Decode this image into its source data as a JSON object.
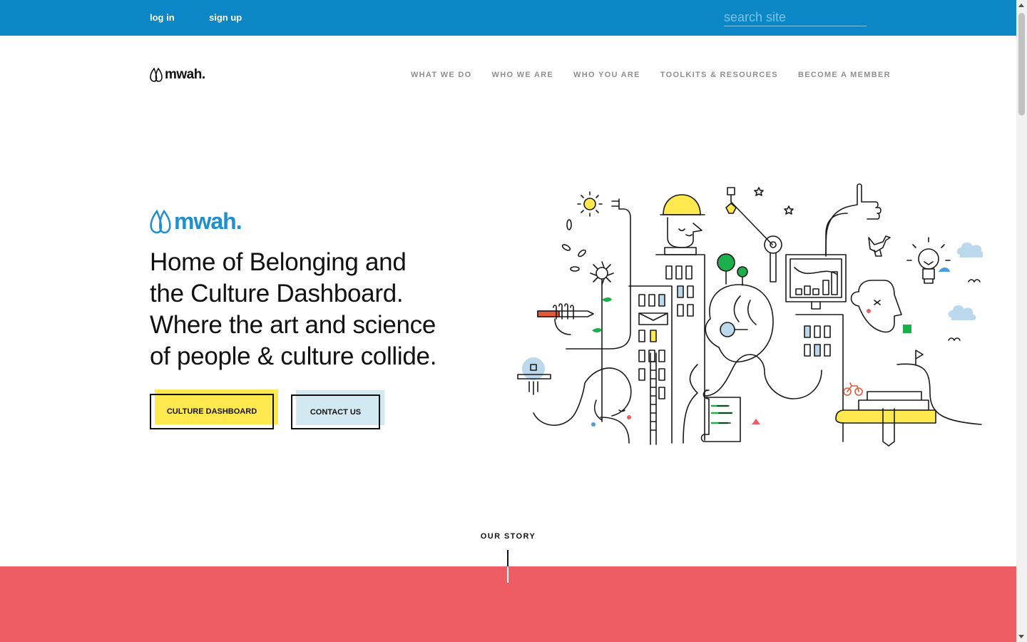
{
  "topbar": {
    "login": "log in",
    "signup": "sign up",
    "search_placeholder": "search site"
  },
  "header": {
    "logo_text": "mwah.",
    "nav": [
      "WHAT WE DO",
      "WHO WE ARE",
      "WHO YOU ARE",
      "TOOLKITS & RESOURCES",
      "BECOME A MEMBER"
    ]
  },
  "hero": {
    "logo_text": "mwah.",
    "headline_lines": [
      "Home of Belonging and",
      "the Culture Dashboard.",
      "Where the art and science",
      "of people & culture collide."
    ],
    "cta_primary": "CULTURE DASHBOARD",
    "cta_secondary": "CONTACT US"
  },
  "story": {
    "label": "OUR STORY"
  },
  "colors": {
    "topbar": "#0b87c5",
    "brand_blue": "#1f8fcd",
    "yellow": "#ffe94f",
    "light_blue": "#d3e9f1",
    "story_band": "#ef5d64"
  },
  "icons": [
    "drop-logo-icon",
    "hero-illustration"
  ]
}
